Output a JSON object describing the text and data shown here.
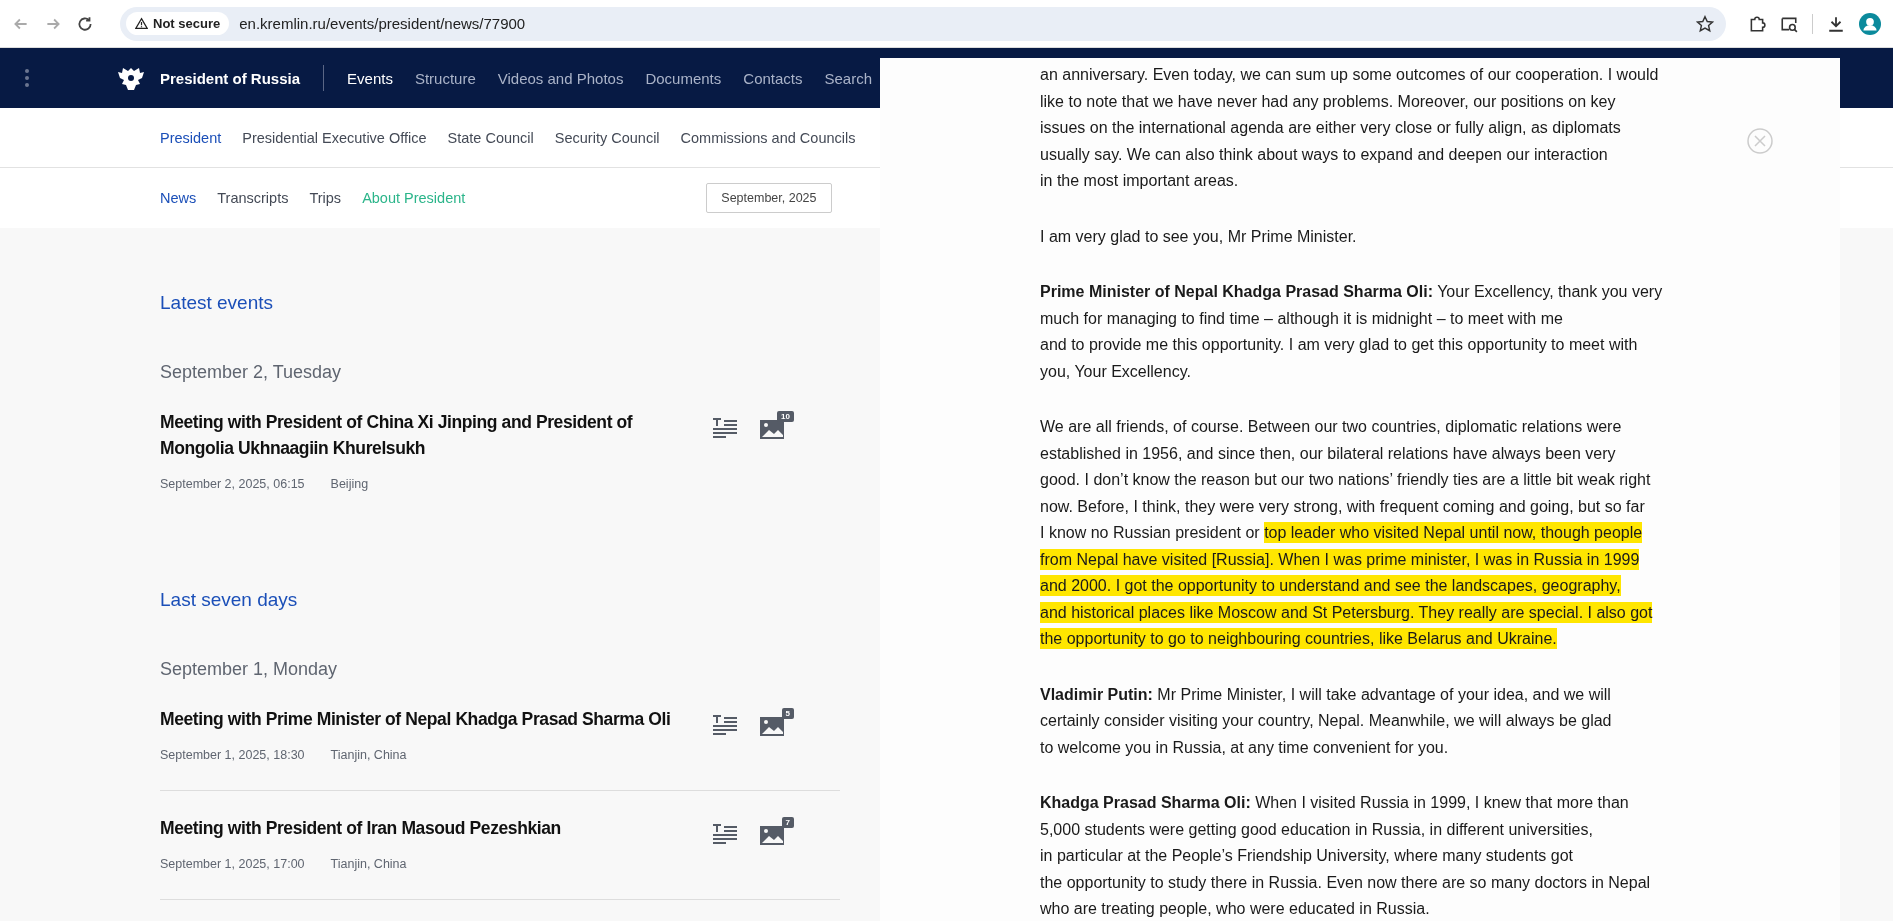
{
  "browser": {
    "security": "Not secure",
    "url": "en.kremlin.ru/events/president/news/77900"
  },
  "site": {
    "title": "President of Russia",
    "nav": [
      {
        "label": "Events",
        "selected": true
      },
      {
        "label": "Structure",
        "selected": false
      },
      {
        "label": "Videos and Photos",
        "selected": false
      },
      {
        "label": "Documents",
        "selected": false
      },
      {
        "label": "Contacts",
        "selected": false
      },
      {
        "label": "Search",
        "selected": false
      }
    ],
    "subnav": [
      {
        "label": "President",
        "selected": true
      },
      {
        "label": "Presidential Executive Office",
        "selected": false
      },
      {
        "label": "State Council",
        "selected": false
      },
      {
        "label": "Security Council",
        "selected": false
      },
      {
        "label": "Commissions and Councils",
        "selected": false
      }
    ],
    "tabs": [
      {
        "label": "News",
        "selected": true,
        "kind": "link"
      },
      {
        "label": "Transcripts",
        "selected": false,
        "kind": "link"
      },
      {
        "label": "Trips",
        "selected": false,
        "kind": "link"
      },
      {
        "label": "About President",
        "selected": false,
        "kind": "accent"
      }
    ],
    "month": "September, 2025"
  },
  "sections": [
    {
      "heading": "Latest events",
      "dividers": false,
      "groups": [
        {
          "date": "September 2, Tuesday",
          "events": [
            {
              "title": "Meeting with President of China Xi Jinping and President of Mongolia Ukhnaagiin Khurelsukh",
              "time": "September 2, 2025, 06:15",
              "place": "Beijing",
              "photos": "10"
            }
          ]
        }
      ]
    },
    {
      "heading": "Last seven days",
      "dividers": true,
      "groups": [
        {
          "date": "September 1, Monday",
          "events": [
            {
              "title": "Meeting with Prime Minister of Nepal Khadga Prasad Sharma Oli",
              "time": "September 1, 2025, 18:30",
              "place": "Tianjin, China",
              "photos": "5"
            },
            {
              "title": "Meeting with President of Iran Masoud Pezeshkian",
              "time": "September 1, 2025, 17:00",
              "place": "Tianjin, China",
              "photos": "7"
            }
          ]
        }
      ]
    }
  ],
  "transcript": [
    {
      "lines": [
        [
          {
            "text": "an anniversary. Even today, we can sum up some outcomes of our cooperation. I would",
            "highlighted": false
          }
        ],
        [
          {
            "text": "like to note that we have never had any problems. Moreover, our positions on key",
            "highlighted": false
          }
        ],
        [
          {
            "text": "issues on the international agenda are either very close or fully align, as diplomats",
            "highlighted": false
          }
        ],
        [
          {
            "text": "usually say. We can also think about ways to expand and deepen our interaction",
            "highlighted": false
          }
        ],
        [
          {
            "text": "in the most important areas.",
            "highlighted": false
          }
        ]
      ]
    },
    {
      "lines": [
        [
          {
            "text": "I am very glad to see you, Mr Prime Minister.",
            "highlighted": false
          }
        ]
      ]
    },
    {
      "lines": [
        [
          {
            "text": "**Prime Minister of Nepal Khadga Prasad Sharma Oli:** Your Excellency, thank you very",
            "highlighted": false
          }
        ],
        [
          {
            "text": "much for managing to find time – although it is midnight – to meet with me",
            "highlighted": false
          }
        ],
        [
          {
            "text": "and to provide me this opportunity. I am very glad to get this opportunity to meet with",
            "highlighted": false
          }
        ],
        [
          {
            "text": "you, Your Excellency.",
            "highlighted": false
          }
        ]
      ]
    },
    {
      "lines": [
        [
          {
            "text": "We are all friends, of course. Between our two countries, diplomatic relations were",
            "highlighted": false
          }
        ],
        [
          {
            "text": "established in 1956, and since then, our bilateral relations have always been very",
            "highlighted": false
          }
        ],
        [
          {
            "text": "good. I don’t know the reason but our two nations’ friendly ties are a little bit weak right",
            "highlighted": false
          }
        ],
        [
          {
            "text": "now. Before, I think, they were very strong, with frequent coming and going, but so far",
            "highlighted": false
          }
        ],
        [
          {
            "text": "I know no Russian president or ",
            "highlighted": false
          },
          {
            "text": "top leader who visited Nepal until now, though people",
            "highlighted": true
          }
        ],
        [
          {
            "text": "from Nepal have visited [Russia]. When I was prime minister, I was in Russia in 1999",
            "highlighted": true
          }
        ],
        [
          {
            "text": "and 2000. I got the opportunity to understand and see the landscapes, geography,",
            "highlighted": true
          }
        ],
        [
          {
            "text": "and historical places like Moscow and St Petersburg. They really are special. I also got",
            "highlighted": true
          }
        ],
        [
          {
            "text": "the opportunity to go to neighbouring countries, like Belarus and Ukraine.",
            "highlighted": true
          }
        ]
      ]
    },
    {
      "lines": [
        [
          {
            "text": "**Vladimir Putin:** Mr Prime Minister, I will take advantage of your idea, and we will",
            "highlighted": false
          }
        ],
        [
          {
            "text": "certainly consider visiting your country, Nepal. Meanwhile, we will always be glad",
            "highlighted": false
          }
        ],
        [
          {
            "text": "to welcome you in Russia, at any time convenient for you.",
            "highlighted": false
          }
        ]
      ]
    },
    {
      "lines": [
        [
          {
            "text": "**Khadga Prasad Sharma Oli:** When I visited Russia in 1999, I knew that more than",
            "highlighted": false
          }
        ],
        [
          {
            "text": "5,000 students were getting good education in Russia, in different universities,",
            "highlighted": false
          }
        ],
        [
          {
            "text": "in particular at the People’s Friendship University, where many students got",
            "highlighted": false
          }
        ],
        [
          {
            "text": "the opportunity to study there in Russia. Even now there are so many doctors in Nepal",
            "highlighted": false
          }
        ],
        [
          {
            "text": "who are treating people, who were educated in Russia.",
            "highlighted": false
          }
        ]
      ]
    }
  ]
}
